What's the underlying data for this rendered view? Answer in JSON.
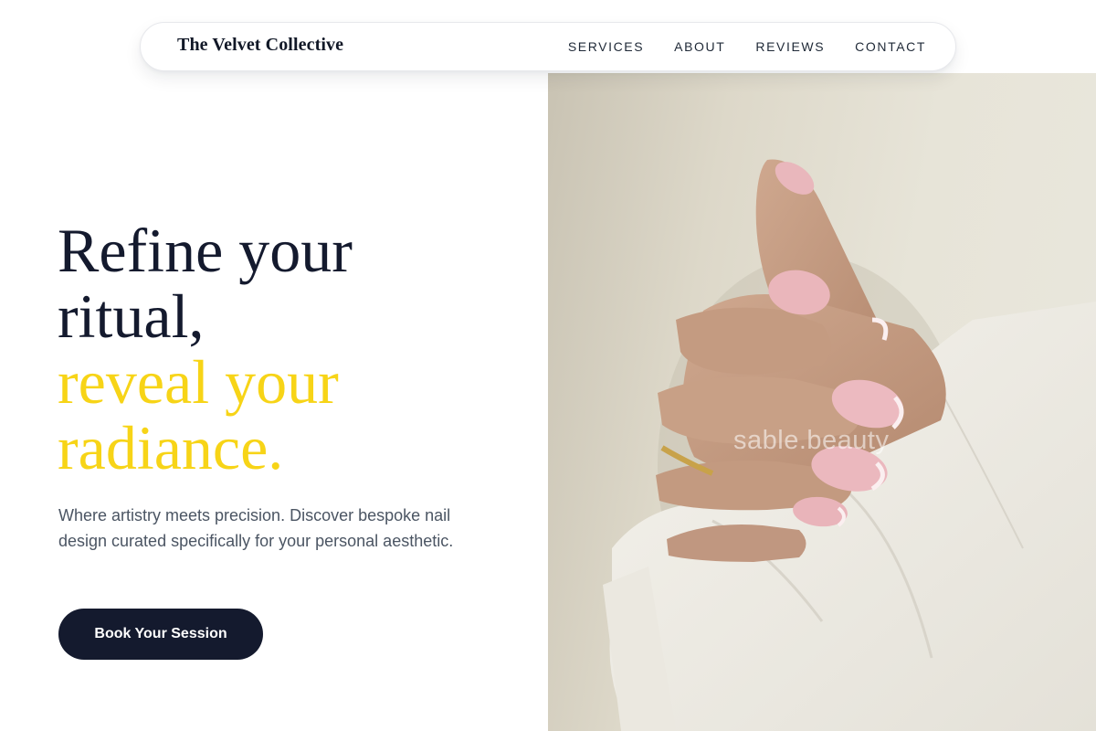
{
  "brand": {
    "name": "The Velvet Collective"
  },
  "nav": {
    "items": [
      {
        "label": "SERVICES"
      },
      {
        "label": "ABOUT"
      },
      {
        "label": "REVIEWS"
      },
      {
        "label": "CONTACT"
      }
    ]
  },
  "hero": {
    "heading_line_1": "Refine your",
    "heading_line_2": "ritual,",
    "heading_accent_line_1": "reveal your",
    "heading_accent_line_2": "radiance.",
    "subtext": "Where artistry meets precision. Discover bespoke nail design curated specifically for your personal aesthetic.",
    "cta_label": "Book Your Session"
  },
  "photo": {
    "watermark": "sable.beauty"
  },
  "colors": {
    "primary": "#141a2e",
    "accent": "#f7d417",
    "muted_text": "#4b5563"
  }
}
